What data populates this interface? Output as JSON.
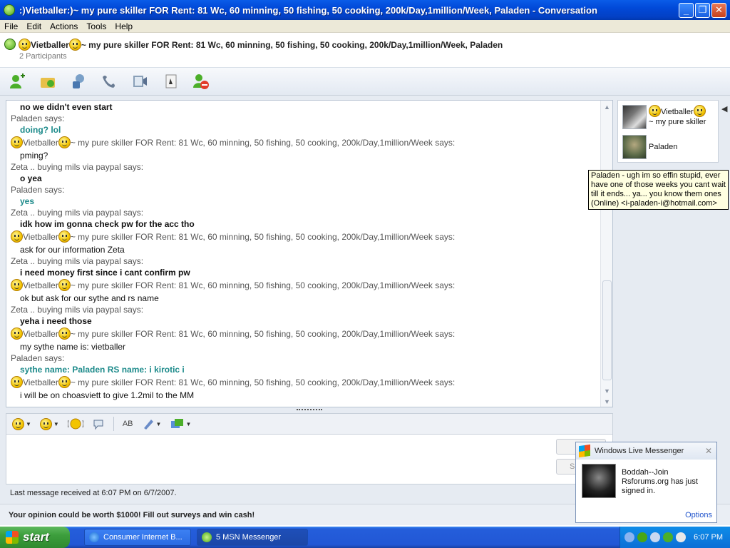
{
  "window": {
    "title": ":)Vietballer:)~  my pure skiller  FOR Rent: 81 Wc, 60 minning,  50 fishing, 50 cooking, 200k/Day,1million/Week, Paladen - Conversation",
    "minimize_glyph": "_",
    "maximize_glyph": "❐",
    "close_glyph": "✕"
  },
  "menu": [
    "File",
    "Edit",
    "Actions",
    "Tools",
    "Help"
  ],
  "header": {
    "name_prefix": "Vietballer",
    "title_rest": "~  my pure skiller  FOR Rent: 81 Wc, 60 minning,  50 fishing, 50 cooking, 200k/Day,1million/Week, Paladen",
    "participants": "2 Participants"
  },
  "toolbar": {
    "icons": [
      "invite-contact-icon",
      "send-files-icon",
      "video-call-icon",
      "voice-call-icon",
      "activities-icon",
      "games-icon",
      "block-icon"
    ]
  },
  "chat": {
    "lines": [
      {
        "kind": "msg-bold",
        "text": "no we didn't even start"
      },
      {
        "kind": "says",
        "text": "Paladen says:"
      },
      {
        "kind": "msg-teal",
        "text": "doing? lol"
      },
      {
        "kind": "namesays",
        "name": "Vietballer",
        "rest": "~  my pure skiller  FOR Rent: 81 Wc, 60 minning,  50 fishing, 50 cooking, 200k/Day,1million/Week says:"
      },
      {
        "kind": "msg-plain",
        "text": "pming?"
      },
      {
        "kind": "says",
        "text": "Zeta .. buying mils via paypal says:"
      },
      {
        "kind": "msg-bold",
        "text": "o yea"
      },
      {
        "kind": "says",
        "text": "Paladen says:"
      },
      {
        "kind": "msg-teal",
        "text": "yes"
      },
      {
        "kind": "says",
        "text": "Zeta .. buying mils via paypal says:"
      },
      {
        "kind": "msg-bold",
        "text": "idk how im gonna check pw for the acc tho"
      },
      {
        "kind": "namesays",
        "name": "Vietballer",
        "rest": "~  my pure skiller  FOR Rent: 81 Wc, 60 minning,  50 fishing, 50 cooking, 200k/Day,1million/Week says:"
      },
      {
        "kind": "msg-plain",
        "text": "ask for our information Zeta"
      },
      {
        "kind": "says",
        "text": "Zeta .. buying mils via paypal says:"
      },
      {
        "kind": "msg-bold",
        "text": "i need money first since i cant confirm pw"
      },
      {
        "kind": "namesays",
        "name": "Vietballer",
        "rest": "~  my pure skiller  FOR Rent: 81 Wc, 60 minning,  50 fishing, 50 cooking, 200k/Day,1million/Week says:"
      },
      {
        "kind": "msg-plain",
        "text": "ok but ask for our sythe and rs name"
      },
      {
        "kind": "says",
        "text": "Zeta .. buying mils via paypal says:"
      },
      {
        "kind": "msg-bold",
        "text": "yeha i need those"
      },
      {
        "kind": "namesays",
        "name": "Vietballer",
        "rest": "~  my pure skiller  FOR Rent: 81 Wc, 60 minning,  50 fishing, 50 cooking, 200k/Day,1million/Week says:"
      },
      {
        "kind": "msg-plain",
        "text": "my sythe name is: vietballer"
      },
      {
        "kind": "says",
        "text": "Paladen says:"
      },
      {
        "kind": "msg-teal",
        "text": "sythe name: Paladen            RS name: i kirotic i"
      },
      {
        "kind": "namesays",
        "name": "Vietballer",
        "rest": "~  my pure skiller  FOR Rent: 81 Wc, 60 minning,  50 fishing, 50 cooking, 200k/Day,1million/Week says:"
      },
      {
        "kind": "msg-plain",
        "text": "i will be on choasviett to give 1.2mil to the MM"
      }
    ]
  },
  "format_bar": {
    "buttons": [
      "emoticon-icon",
      "wink-icon",
      "nudge-icon",
      "voice-clip-icon",
      "font-icon",
      "background-icon",
      "sharing-icon"
    ],
    "font_label": "AB"
  },
  "input": {
    "search_label": "S"
  },
  "status": {
    "last_message": "Last message received at 6:07 PM on 6/7/2007.",
    "ad": "Your opinion could be worth $1000! Fill out surveys and win cash!"
  },
  "participants": [
    {
      "name": "Vietballer",
      "sub": "~  my pure skiller"
    },
    {
      "name": "Paladen"
    }
  ],
  "tooltip": "Paladen - ugh im so effin stupid, ever have one of those weeks you cant wait till it ends... ya... you know them ones (Online) <i-paladen-i@hotmail.com>",
  "toast": {
    "title": "Windows Live Messenger",
    "body": "Boddah--Join Rsforums.org has just signed in.",
    "options": "Options"
  },
  "taskbar": {
    "start": "start",
    "items": [
      "Consumer Internet B...",
      "5 MSN Messenger"
    ],
    "clock": "6:07 PM"
  }
}
